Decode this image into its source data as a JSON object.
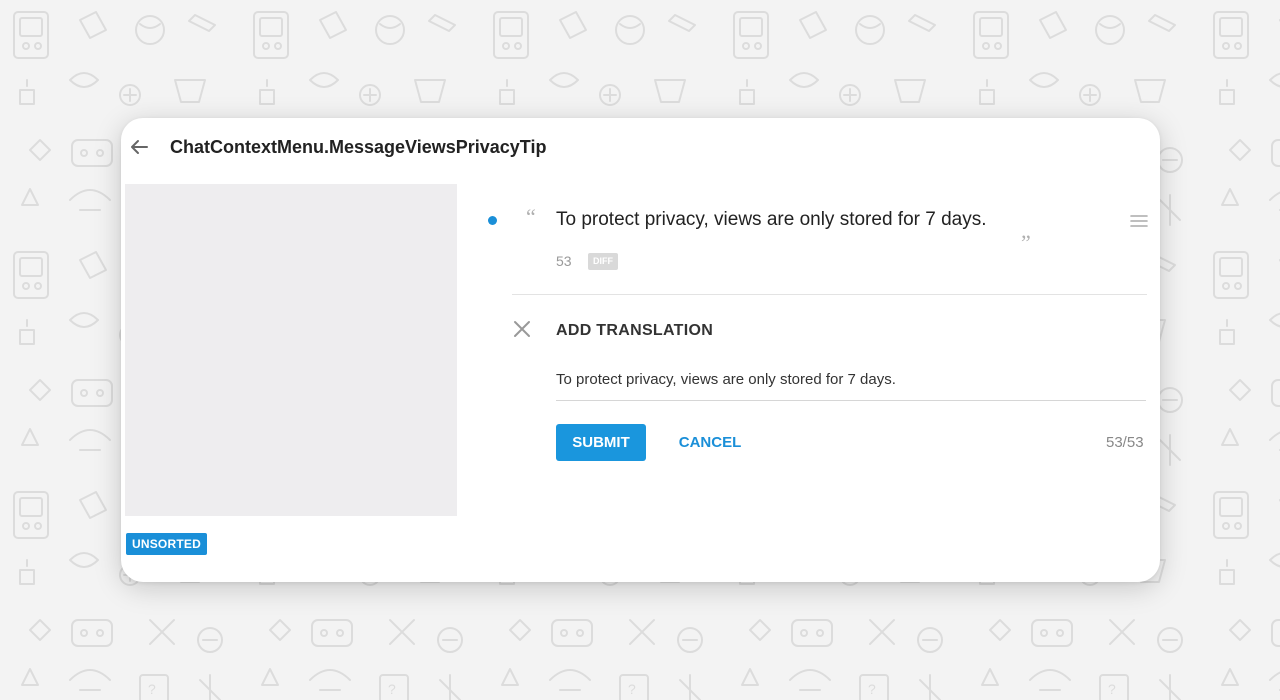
{
  "header": {
    "back_icon": "arrow-left-icon",
    "key_title": "ChatContextMenu.MessageViewsPrivacyTip"
  },
  "screenshot": {
    "tag": "UNSORTED"
  },
  "source": {
    "text": "To protect privacy, views are only stored for 7 days.",
    "char_count": "53",
    "diff_label": "DIFF",
    "quote_open": "“",
    "quote_close": "„",
    "accent": "#1a8fd8"
  },
  "editor": {
    "title": "ADD TRANSLATION",
    "value": "To protect privacy, views are only stored for 7 days.",
    "submit_label": "SUBMIT",
    "cancel_label": "CANCEL",
    "counter": "53/53"
  },
  "colors": {
    "accent": "#1a96dd",
    "background": "#f3f3f3"
  }
}
